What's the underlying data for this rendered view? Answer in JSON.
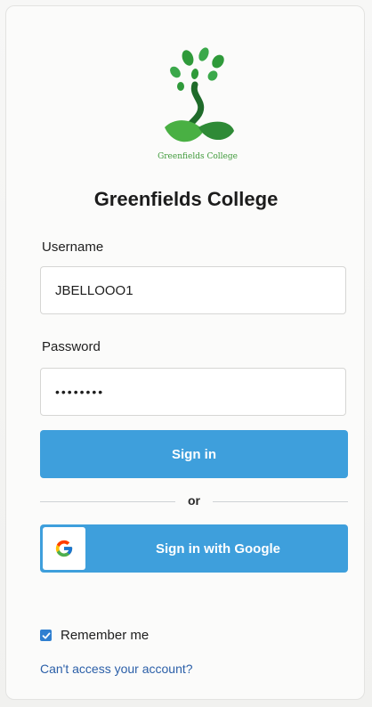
{
  "brand": {
    "logo_text": "Greenfields College",
    "title": "Greenfields College"
  },
  "form": {
    "username_label": "Username",
    "username_value": "JBELLOOO1",
    "password_label": "Password",
    "password_value": "••••••••",
    "sign_in_label": "Sign in",
    "divider_text": "or",
    "google_label": "Sign in with Google",
    "remember_label": "Remember me",
    "remember_checked": true,
    "cant_access_label": "Can't access your account?"
  },
  "colors": {
    "primary": "#3e9fdc",
    "logo_green": "#3f9a3a",
    "link": "#2b5fa8",
    "checkbox": "#2f7fd0"
  },
  "icons": {
    "logo": "tree-logo-icon",
    "google": "google-g-icon",
    "checkbox": "checkmark-icon"
  }
}
